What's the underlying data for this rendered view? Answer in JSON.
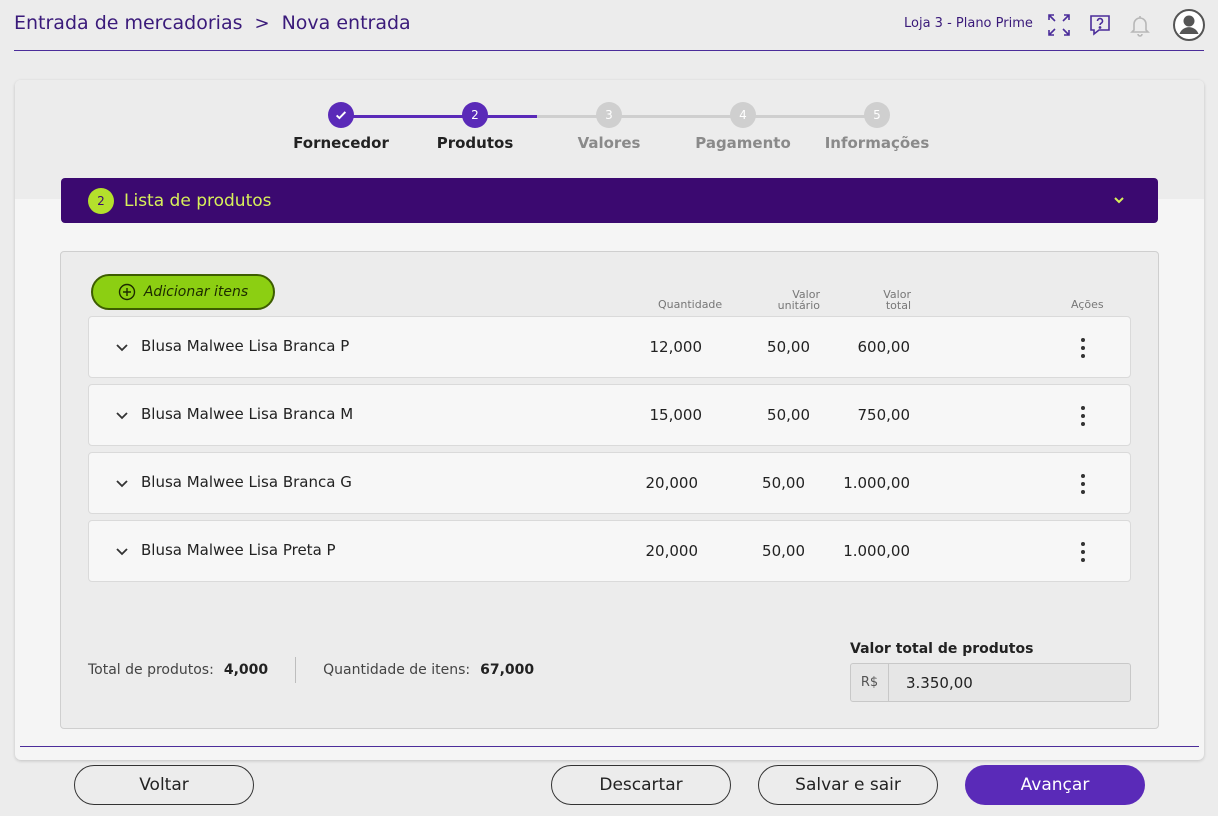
{
  "header": {
    "breadcrumb": [
      "Entrada de mercadorias",
      "Nova entrada"
    ],
    "separator": ">",
    "store": "Loja 3 - Plano Prime",
    "icons": [
      "fullscreen-icon",
      "help-icon",
      "bell-icon",
      "user-avatar-icon"
    ]
  },
  "stepper": {
    "steps": [
      {
        "number": "1",
        "label": "Fornecedor",
        "state": "done"
      },
      {
        "number": "2",
        "label": "Produtos",
        "state": "active"
      },
      {
        "number": "3",
        "label": "Valores",
        "state": "pending"
      },
      {
        "number": "4",
        "label": "Pagamento",
        "state": "pending"
      },
      {
        "number": "5",
        "label": "Informações",
        "state": "pending"
      }
    ]
  },
  "section": {
    "number": "2",
    "title": "Lista de produtos"
  },
  "add_button": "Adicionar itens",
  "columns": {
    "quantity": "Quantidade",
    "unit_value_1": "Valor",
    "unit_value_2": "unitário",
    "total_value_1": "Valor",
    "total_value_2": "total",
    "actions": "Ações"
  },
  "products": [
    {
      "name": "Blusa Malwee Lisa Branca P",
      "quantity": "12,000",
      "unit_value": "50,00",
      "total_value": "600,00"
    },
    {
      "name": "Blusa Malwee Lisa Branca M",
      "quantity": "15,000",
      "unit_value": "50,00",
      "total_value": "750,00"
    },
    {
      "name": "Blusa Malwee Lisa Branca G",
      "quantity": "20,000",
      "unit_value": "50,00",
      "total_value": "1.000,00"
    },
    {
      "name": "Blusa Malwee Lisa Preta P",
      "quantity": "20,000",
      "unit_value": "50,00",
      "total_value": "1.000,00"
    }
  ],
  "summary": {
    "total_products_label": "Total de produtos:",
    "total_products_value": "4,000",
    "items_qty_label": "Quantidade de itens:",
    "items_qty_value": "67,000"
  },
  "total_value": {
    "label": "Valor total de produtos",
    "currency": "R$",
    "value": "3.350,00"
  },
  "footer": {
    "back": "Voltar",
    "discard": "Descartar",
    "save_exit": "Salvar e sair",
    "next": "Avançar"
  },
  "colors": {
    "primary": "#5a2ab8",
    "section_bar": "#3b0970",
    "accent_green": "#8ccf12",
    "section_text": "#d7f05a"
  }
}
